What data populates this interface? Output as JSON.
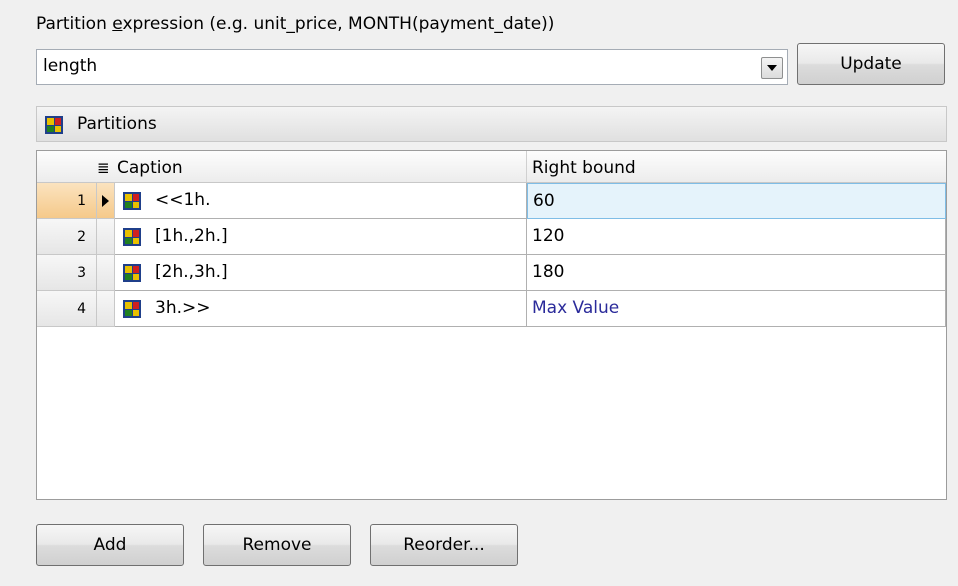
{
  "expression": {
    "label_prefix": "Partition ",
    "label_accel": "e",
    "label_suffix": "xpression (e.g. unit_price, MONTH(payment_date))",
    "value": "length",
    "dropdown_icon": "chevron-down-icon",
    "update_label": "Update"
  },
  "partitions_section": {
    "icon": "partitions-icon",
    "label": "Partitions"
  },
  "grid": {
    "columns": {
      "caption": "Caption",
      "right_bound": "Right bound"
    },
    "rows": [
      {
        "num": "1",
        "caption": "<<1h.",
        "right_bound": "60",
        "current": true
      },
      {
        "num": "2",
        "caption": "[1h.,2h.]",
        "right_bound": "120"
      },
      {
        "num": "3",
        "caption": "[2h.,3h.]",
        "right_bound": "180"
      },
      {
        "num": "4",
        "caption": "3h.>>",
        "right_bound": "Max Value"
      }
    ]
  },
  "actions": {
    "add_label": "Add",
    "remove_label": "Remove",
    "reorder_label": "Reorder..."
  }
}
